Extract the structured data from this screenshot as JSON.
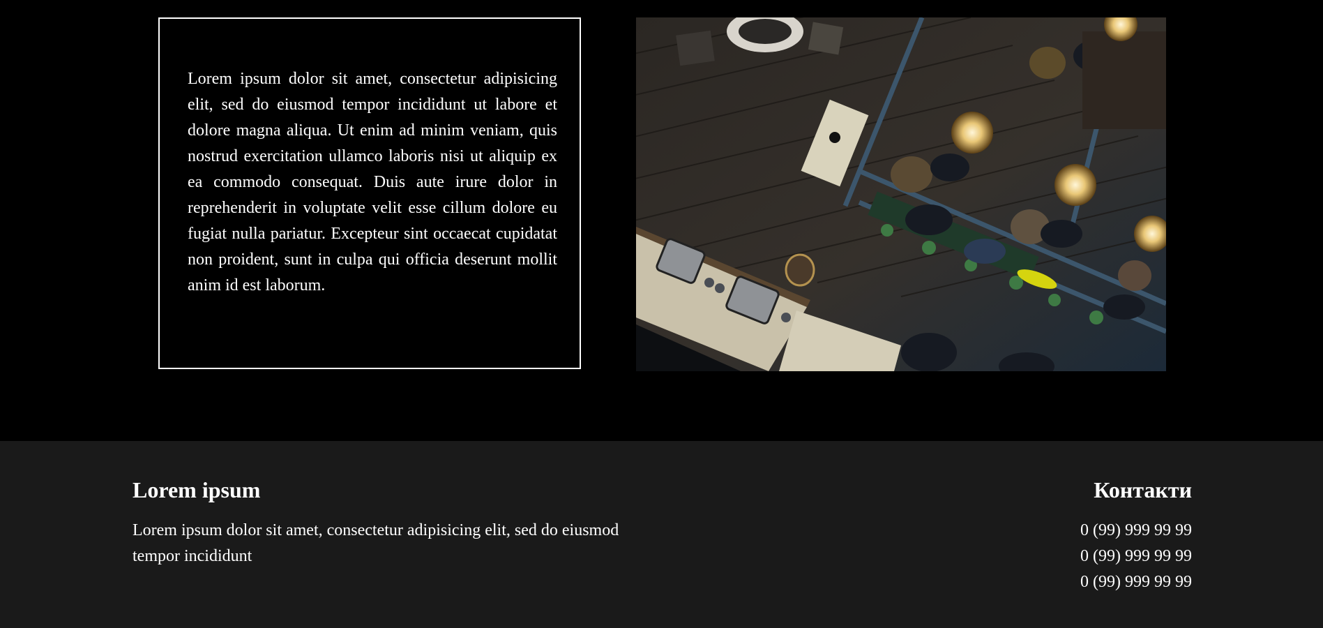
{
  "intro": {
    "body": "Lorem ipsum dolor sit amet, consectetur adipisicing elit, sed do eiusmod tempor incididunt ut labore et dolore magna aliqua. Ut enim ad minim veniam, quis nostrud exercitation ullamco laboris nisi ut aliquip ex ea commodo consequat. Duis aute irure dolor in reprehenderit in voluptate velit esse cillum dolore eu fugiat nulla pariatur. Excepteur sint occaecat cupidatat non proident, sunt in culpa qui officia deserunt mollit anim id est laborum."
  },
  "footer": {
    "about": {
      "title": "Lorem ipsum",
      "text": "Lorem ipsum dolor sit amet, consectetur adipisicing elit, sed do eiusmod tempor incididunt"
    },
    "contacts": {
      "title": "Контакти",
      "phones": [
        "0 (99) 999 99 99",
        "0 (99) 999 99 99",
        "0 (99) 999 99 99"
      ]
    }
  },
  "colors": {
    "page_background": "#000000",
    "footer_background": "#1a1a1a",
    "text": "#ffffff"
  }
}
